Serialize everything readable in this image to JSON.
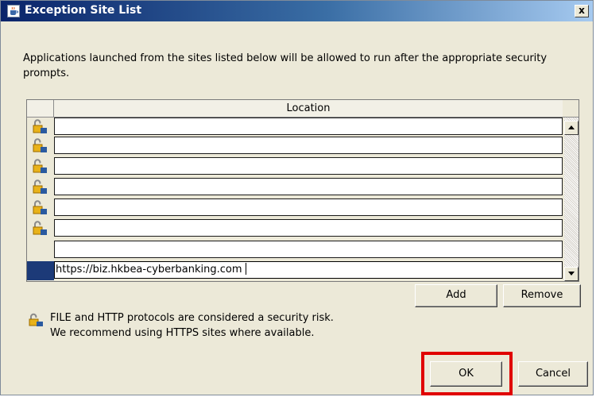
{
  "window": {
    "title": "Exception Site List",
    "close_glyph": "x"
  },
  "intro_text": "Applications launched from the sites listed below will be allowed to run after the appropriate security prompts.",
  "table": {
    "column_header": "Location",
    "rows": [
      {
        "icon": "unlocked-padlock-icon",
        "value": ""
      },
      {
        "icon": "unlocked-padlock-icon",
        "value": ""
      },
      {
        "icon": "unlocked-padlock-icon",
        "value": ""
      },
      {
        "icon": "unlocked-padlock-icon",
        "value": ""
      },
      {
        "icon": "unlocked-padlock-icon",
        "value": ""
      },
      {
        "icon": "unlocked-padlock-icon",
        "value": ""
      },
      {
        "icon": "",
        "value": ""
      },
      {
        "icon": "",
        "value": "https://biz.hkbea-cyberbanking.com",
        "editing": true
      }
    ]
  },
  "buttons": {
    "add": "Add",
    "remove": "Remove",
    "ok": "OK",
    "cancel": "Cancel"
  },
  "warning": {
    "line1": "FILE and HTTP protocols are considered a security risk.",
    "line2": "We recommend using HTTPS sites where available."
  },
  "colors": {
    "highlight": "#e00000",
    "selection": "#1c3a78",
    "titlebar": "#0a246a"
  }
}
